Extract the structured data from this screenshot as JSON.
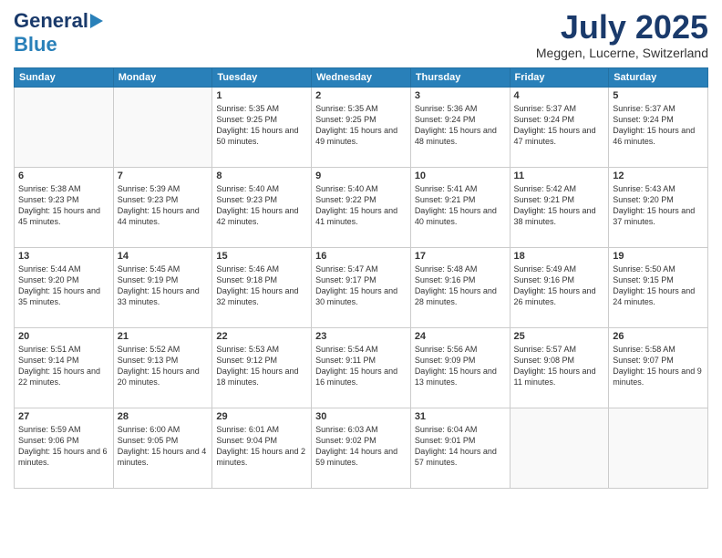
{
  "header": {
    "logo_line1": "General",
    "logo_line2": "Blue",
    "month_title": "July 2025",
    "location": "Meggen, Lucerne, Switzerland"
  },
  "days_of_week": [
    "Sunday",
    "Monday",
    "Tuesday",
    "Wednesday",
    "Thursday",
    "Friday",
    "Saturday"
  ],
  "weeks": [
    [
      {
        "day": "",
        "info": ""
      },
      {
        "day": "",
        "info": ""
      },
      {
        "day": "1",
        "info": "Sunrise: 5:35 AM\nSunset: 9:25 PM\nDaylight: 15 hours\nand 50 minutes."
      },
      {
        "day": "2",
        "info": "Sunrise: 5:35 AM\nSunset: 9:25 PM\nDaylight: 15 hours\nand 49 minutes."
      },
      {
        "day": "3",
        "info": "Sunrise: 5:36 AM\nSunset: 9:24 PM\nDaylight: 15 hours\nand 48 minutes."
      },
      {
        "day": "4",
        "info": "Sunrise: 5:37 AM\nSunset: 9:24 PM\nDaylight: 15 hours\nand 47 minutes."
      },
      {
        "day": "5",
        "info": "Sunrise: 5:37 AM\nSunset: 9:24 PM\nDaylight: 15 hours\nand 46 minutes."
      }
    ],
    [
      {
        "day": "6",
        "info": "Sunrise: 5:38 AM\nSunset: 9:23 PM\nDaylight: 15 hours\nand 45 minutes."
      },
      {
        "day": "7",
        "info": "Sunrise: 5:39 AM\nSunset: 9:23 PM\nDaylight: 15 hours\nand 44 minutes."
      },
      {
        "day": "8",
        "info": "Sunrise: 5:40 AM\nSunset: 9:23 PM\nDaylight: 15 hours\nand 42 minutes."
      },
      {
        "day": "9",
        "info": "Sunrise: 5:40 AM\nSunset: 9:22 PM\nDaylight: 15 hours\nand 41 minutes."
      },
      {
        "day": "10",
        "info": "Sunrise: 5:41 AM\nSunset: 9:21 PM\nDaylight: 15 hours\nand 40 minutes."
      },
      {
        "day": "11",
        "info": "Sunrise: 5:42 AM\nSunset: 9:21 PM\nDaylight: 15 hours\nand 38 minutes."
      },
      {
        "day": "12",
        "info": "Sunrise: 5:43 AM\nSunset: 9:20 PM\nDaylight: 15 hours\nand 37 minutes."
      }
    ],
    [
      {
        "day": "13",
        "info": "Sunrise: 5:44 AM\nSunset: 9:20 PM\nDaylight: 15 hours\nand 35 minutes."
      },
      {
        "day": "14",
        "info": "Sunrise: 5:45 AM\nSunset: 9:19 PM\nDaylight: 15 hours\nand 33 minutes."
      },
      {
        "day": "15",
        "info": "Sunrise: 5:46 AM\nSunset: 9:18 PM\nDaylight: 15 hours\nand 32 minutes."
      },
      {
        "day": "16",
        "info": "Sunrise: 5:47 AM\nSunset: 9:17 PM\nDaylight: 15 hours\nand 30 minutes."
      },
      {
        "day": "17",
        "info": "Sunrise: 5:48 AM\nSunset: 9:16 PM\nDaylight: 15 hours\nand 28 minutes."
      },
      {
        "day": "18",
        "info": "Sunrise: 5:49 AM\nSunset: 9:16 PM\nDaylight: 15 hours\nand 26 minutes."
      },
      {
        "day": "19",
        "info": "Sunrise: 5:50 AM\nSunset: 9:15 PM\nDaylight: 15 hours\nand 24 minutes."
      }
    ],
    [
      {
        "day": "20",
        "info": "Sunrise: 5:51 AM\nSunset: 9:14 PM\nDaylight: 15 hours\nand 22 minutes."
      },
      {
        "day": "21",
        "info": "Sunrise: 5:52 AM\nSunset: 9:13 PM\nDaylight: 15 hours\nand 20 minutes."
      },
      {
        "day": "22",
        "info": "Sunrise: 5:53 AM\nSunset: 9:12 PM\nDaylight: 15 hours\nand 18 minutes."
      },
      {
        "day": "23",
        "info": "Sunrise: 5:54 AM\nSunset: 9:11 PM\nDaylight: 15 hours\nand 16 minutes."
      },
      {
        "day": "24",
        "info": "Sunrise: 5:56 AM\nSunset: 9:09 PM\nDaylight: 15 hours\nand 13 minutes."
      },
      {
        "day": "25",
        "info": "Sunrise: 5:57 AM\nSunset: 9:08 PM\nDaylight: 15 hours\nand 11 minutes."
      },
      {
        "day": "26",
        "info": "Sunrise: 5:58 AM\nSunset: 9:07 PM\nDaylight: 15 hours\nand 9 minutes."
      }
    ],
    [
      {
        "day": "27",
        "info": "Sunrise: 5:59 AM\nSunset: 9:06 PM\nDaylight: 15 hours\nand 6 minutes."
      },
      {
        "day": "28",
        "info": "Sunrise: 6:00 AM\nSunset: 9:05 PM\nDaylight: 15 hours\nand 4 minutes."
      },
      {
        "day": "29",
        "info": "Sunrise: 6:01 AM\nSunset: 9:04 PM\nDaylight: 15 hours\nand 2 minutes."
      },
      {
        "day": "30",
        "info": "Sunrise: 6:03 AM\nSunset: 9:02 PM\nDaylight: 14 hours\nand 59 minutes."
      },
      {
        "day": "31",
        "info": "Sunrise: 6:04 AM\nSunset: 9:01 PM\nDaylight: 14 hours\nand 57 minutes."
      },
      {
        "day": "",
        "info": ""
      },
      {
        "day": "",
        "info": ""
      }
    ]
  ]
}
